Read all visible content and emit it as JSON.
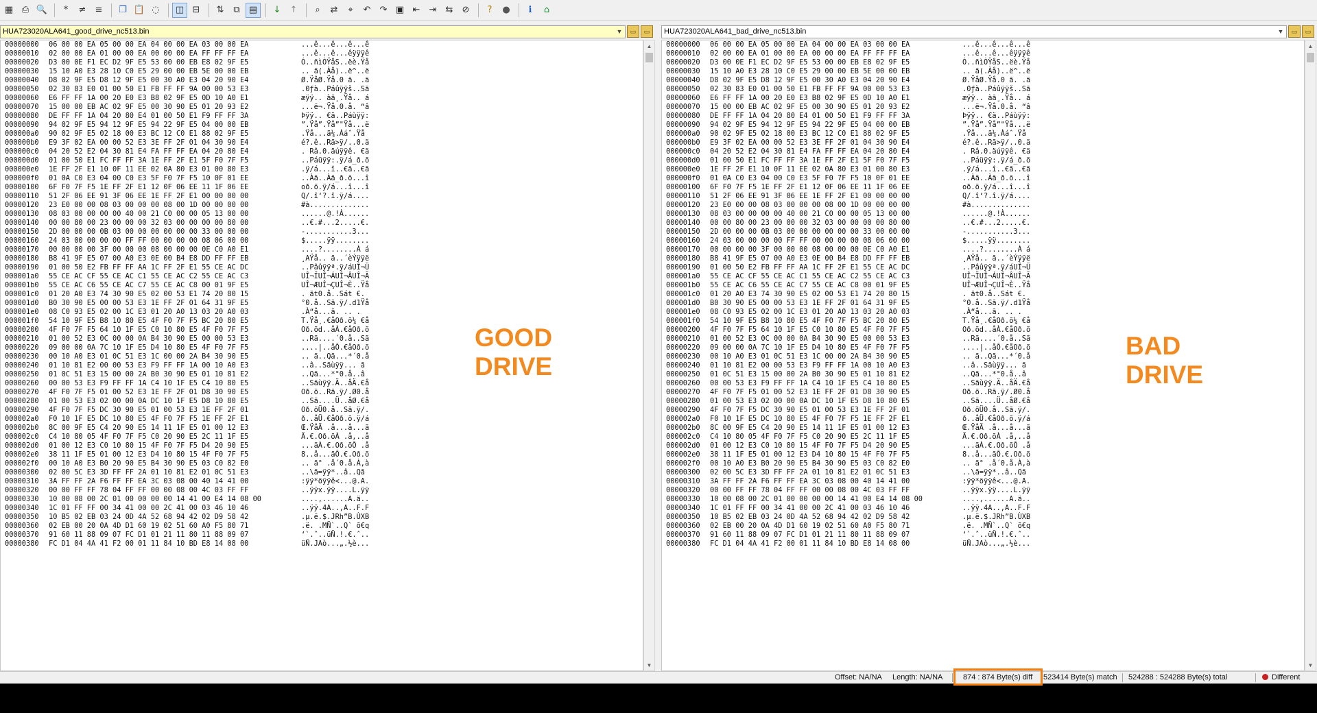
{
  "toolbar": {
    "icons": [
      "table-icon",
      "print-icon",
      "print-preview-icon",
      "asterisk-icon",
      "not-equal-icon",
      "equal-icon",
      "copy-icon",
      "paste-icon",
      "eraser-icon",
      "side-by-side-icon",
      "over-under-icon",
      "sync-icon",
      "compare-icon",
      "refresh-icon",
      "next-diff-icon",
      "prev-diff-icon",
      "find-icon",
      "replace-icon",
      "bookmark-icon",
      "undo-icon",
      "redo-icon",
      "save-icon",
      "copy-left-icon",
      "copy-right-icon",
      "copy-all-icon",
      "ignore-icon",
      "help-icon",
      "stop-icon",
      "info-icon",
      "home-icon"
    ]
  },
  "left": {
    "path": "HUA723020ALA641_good_drive_nc513.bin",
    "label_line1": "GOOD",
    "label_line2": "DRIVE",
    "accent": "#ffffc4"
  },
  "right": {
    "path": "HUA723020ALA641_bad_drive_nc513.bin",
    "label_line1": "BAD",
    "label_line2": "DRIVE"
  },
  "label_color": "#f28a20",
  "rows": [
    {
      "offset": "00000000",
      "hex": "06 00 00 EA 05 00 00 EA 04 00 00 EA 03 00 00 EA",
      "ascii": "...ê...ê...ê...ê"
    },
    {
      "offset": "00000010",
      "hex": "02 00 00 EA 01 00 00 EA 00 00 00 EA FF FF FF EA",
      "ascii": "...ê...ê...êÿÿÿê"
    },
    {
      "offset": "00000020",
      "hex": "D3 00 0E F1 EC D2 9F E5 53 00 00 EB E8 02 9F E5",
      "ascii": "Ó..ñìÒŸåS..ëè.Ÿå"
    },
    {
      "offset": "00000030",
      "hex": "15 10 A0 E3 28 10 C0 E5 29 00 00 EB 5E 00 00 EB",
      "ascii": ".. ã(.Àå)..ë^..ë"
    },
    {
      "offset": "00000040",
      "hex": "D8 02 9F E5 D8 12 9F E5 00 30 A0 E3 04 20 90 E4",
      "ascii": "Ø.ŸåØ.Ÿå.0 ã. .ä"
    },
    {
      "offset": "00000050",
      "hex": "02 30 83 E0 01 00 50 E1 FB FF FF 9A 00 00 53 E3",
      "ascii": ".0ƒà..Páûÿÿš..Sã"
    },
    {
      "offset": "00000060",
      "hex": "E6 FF FF 1A 00 20 E0 E3 B8 02 9F E5 0D 10 A0 E1",
      "ascii": "æÿÿ.. àã¸.Ÿå.. á"
    },
    {
      "offset": "00000070",
      "hex": "15 00 00 EB AC 02 9F E5 00 30 90 E5 01 20 93 E2",
      "ascii": "...ë¬.Ÿå.0.å. “â"
    },
    {
      "offset": "00000080",
      "hex": "DE FF FF 1A 04 20 80 E4 01 00 50 E1 F9 FF FF 3A",
      "ascii": "Þÿÿ.. €ä..Páùÿÿ:"
    },
    {
      "offset": "00000090",
      "hex": "94 02 9F E5 94 12 9F E5 94 22 9F E5 04 00 00 EB",
      "ascii": "”.Ÿå”.Ÿå”\"Ÿå...ë"
    },
    {
      "offset": "000000a0",
      "hex": "90 02 9F E5 02 18 00 E3 BC 12 C0 E1 88 02 9F E5",
      "ascii": ".Ÿå...ã¼.Àáˆ.Ÿå"
    },
    {
      "offset": "000000b0",
      "hex": "E9 3F 02 EA 00 00 52 E3 3E FF 2F 01 04 30 90 E4",
      "ascii": "é?.ê..Rã>ÿ/..0.ä"
    },
    {
      "offset": "000000c0",
      "hex": "04 20 52 E2 04 30 81 E4 FA FF FF EA 04 20 80 E4",
      "ascii": ". Râ.0.äúÿÿê. €ä"
    },
    {
      "offset": "000000d0",
      "hex": "01 00 50 E1 FC FF FF 3A 1E FF 2F E1 5F F0 7F F5",
      "ascii": "..Páüÿÿ:.ÿ/á_ð.õ"
    },
    {
      "offset": "000000e0",
      "hex": "1E FF 2F E1 10 0F 11 EE 02 0A 80 E3 01 00 80 E3",
      "ascii": ".ÿ/á...î..€ã..€ã"
    },
    {
      "offset": "000000f0",
      "hex": "01 0A C0 E3 04 00 C0 E3 5F F0 7F F5 10 0F 01 EE",
      "ascii": "..Àã..Àã_ð.õ...î"
    },
    {
      "offset": "00000100",
      "hex": "6F F0 7F F5 1E FF 2F E1 12 0F 06 EE 11 1F 06 EE",
      "ascii": "oð.õ.ÿ/á...î...î"
    },
    {
      "offset": "00000110",
      "hex": "51 2F 06 EE 91 3F 06 EE 1E FF 2F E1 00 00 00 00",
      "ascii": "Q/.î‘?.î.ÿ/á...."
    },
    {
      "offset": "00000120",
      "hex": "23 E0 00 00 08 03 00 00 00 08 00 1D 00 00 00 00",
      "ascii": "#à.............."
    },
    {
      "offset": "00000130",
      "hex": "08 03 00 00 00 00 40 00 21 C0 00 00 05 13 00 00",
      "ascii": "......@.!À......"
    },
    {
      "offset": "00000140",
      "hex": "00 00 80 00 23 00 00 00 32 03 00 00 00 00 80 00",
      "ascii": "..€.#...2.....€."
    },
    {
      "offset": "00000150",
      "hex": "2D 00 00 00 0B 03 00 00 00 00 00 00 33 00 00 00",
      "ascii": "-...........3..."
    },
    {
      "offset": "00000160",
      "hex": "24 03 00 00 00 00 FF FF 00 00 00 00 08 06 00 00",
      "ascii": "$.....ÿÿ........"
    },
    {
      "offset": "00000170",
      "hex": "00 00 00 00 3F 00 00 00 08 00 00 00 0E C0 A0 E1",
      "ascii": "....?........À á"
    },
    {
      "offset": "00000180",
      "hex": "B8 41 9F E5 07 00 A0 E3 0E 00 B4 E8 DD FF FF EB",
      "ascii": "¸AŸå.. ã..´èÝÿÿë"
    },
    {
      "offset": "00000190",
      "hex": "01 00 50 E2 FB FF FF AA 1C FF 2F E1 55 CE AC DC",
      "ascii": "..Pâûÿÿª.ÿ/áUÎ¬Ü"
    },
    {
      "offset": "000001a0",
      "hex": "55 CE AC CF 55 CE AC C1 55 CE AC C2 55 CE AC C3",
      "ascii": "UÎ¬ÏUÎ¬ÁUÎ¬ÂUÎ¬Ã"
    },
    {
      "offset": "000001b0",
      "hex": "55 CE AC C6 55 CE AC C7 55 CE AC C8 00 01 9F E5",
      "ascii": "UÎ¬ÆUÎ¬ÇUÎ¬È..Ÿå"
    },
    {
      "offset": "000001c0",
      "hex": "01 20 A0 E3 74 30 90 E5 02 00 53 E1 74 20 80 15",
      "ascii": ". ãt0.å..Sát €."
    },
    {
      "offset": "000001d0",
      "hex": "B0 30 90 E5 00 00 53 E3 1E FF 2F 01 64 31 9F E5",
      "ascii": "°0.å..Sã.ÿ/.d1Ÿå"
    },
    {
      "offset": "000001e0",
      "hex": "08 C0 93 E5 02 00 1C E3 01 20 A0 13 03 20 A0 03",
      "ascii": ".À“å...ã. .. ."
    },
    {
      "offset": "000001f0",
      "hex": "54 10 9F E5 B8 10 80 E5 4F F0 7F F5 BC 20 80 E5",
      "ascii": "T.Ÿå¸.€åOð.õ¼ €å"
    },
    {
      "offset": "00000200",
      "hex": "4F F0 7F F5 64 10 1F E5 C0 10 80 E5 4F F0 7F F5",
      "ascii": "Oð.õd..åÀ.€åOð.õ"
    },
    {
      "offset": "00000210",
      "hex": "01 00 52 E3 0C 00 00 0A B4 30 90 E5 00 00 53 E3",
      "ascii": "..Rã....´0.å..Sã"
    },
    {
      "offset": "00000220",
      "hex": "09 00 00 0A 7C 10 1F E5 D4 10 80 E5 4F F0 7F F5",
      "ascii": "....|..åÔ.€åOð.õ"
    },
    {
      "offset": "00000230",
      "hex": "00 10 A0 E3 01 0C 51 E3 1C 00 00 2A B4 30 90 E5",
      "ascii": ".. ã..Qã...*´0.å"
    },
    {
      "offset": "00000240",
      "hex": "01 10 81 E2 00 00 53 E3 F9 FF FF 1A 00 10 A0 E3",
      "ascii": "..â..Sãùÿÿ... ã"
    },
    {
      "offset": "00000250",
      "hex": "01 0C 51 E3 15 00 00 2A B0 30 90 E5 01 10 81 E2",
      "ascii": "..Qã...*°0.å..â"
    },
    {
      "offset": "00000260",
      "hex": "00 00 53 E3 F9 FF FF 1A C4 10 1F E5 C4 10 80 E5",
      "ascii": "..Sãùÿÿ.Ä..åÄ.€å"
    },
    {
      "offset": "00000270",
      "hex": "4F F0 7F F5 01 00 52 E3 1E FF 2F 01 D8 30 90 E5",
      "ascii": "Oð.õ..Rã.ÿ/.Ø0.å"
    },
    {
      "offset": "00000280",
      "hex": "01 00 53 E3 02 00 00 0A DC 10 1F E5 D8 10 80 E5",
      "ascii": "..Sã....Ü..åØ.€å"
    },
    {
      "offset": "00000290",
      "hex": "4F F0 7F F5 DC 30 90 E5 01 00 53 E3 1E FF 2F 01",
      "ascii": "Oð.õÜ0.å..Sã.ÿ/."
    },
    {
      "offset": "000002a0",
      "hex": "F0 10 1F E5 DC 10 80 E5 4F F0 7F F5 1E FF 2F E1",
      "ascii": "ð..åÜ.€åOð.õ.ÿ/á"
    },
    {
      "offset": "000002b0",
      "hex": "8C 00 9F E5 C4 20 90 E5 14 11 1F E5 01 00 12 E3",
      "ascii": "Œ.ŸåÄ .å...å...ã"
    },
    {
      "offset": "000002c0",
      "hex": "C4 10 80 05 4F F0 7F F5 C0 20 90 E5 2C 11 1F E5",
      "ascii": "Ä.€.Oð.õÀ .å,..å"
    },
    {
      "offset": "000002d0",
      "hex": "01 00 12 E3 C0 10 80 15 4F F0 7F F5 D4 20 90 E5",
      "ascii": "...ãÀ.€.Oð.õÔ .å"
    },
    {
      "offset": "000002e0",
      "hex": "38 11 1F E5 01 00 12 E3 D4 10 80 15 4F F0 7F F5",
      "ascii": "8..å...ãÔ.€.Oð.õ"
    },
    {
      "offset": "000002f0",
      "hex": "00 10 A0 E3 B0 20 90 E5 B4 30 90 E5 03 C0 82 E0",
      "ascii": ".. ã° .å´0.å.À‚à"
    },
    {
      "offset": "00000300",
      "hex": "02 00 5C E3 3D FF FF 2A 01 10 81 E2 01 0C 51 E3",
      "ascii": "..\\ã=ÿÿ*..â..Qã"
    },
    {
      "offset": "00000310",
      "hex": "3A FF FF 2A F6 FF FF EA 3C 03 08 00 40 14 41 00",
      "ascii": ":ÿÿ*öÿÿê<...@.A."
    },
    {
      "offset": "00000320",
      "hex": "00 00 FF FF 78 04 FF FF 00 00 08 00 4C 03 FF FF",
      "ascii": "..ÿÿx.ÿÿ....L.ÿÿ"
    },
    {
      "offset": "00000330",
      "hex": "10 00 08 00 2C 01 00 00 00 00 14 41 00 E4 14 08 00",
      "ascii": "....,......A.ä.."
    },
    {
      "offset": "00000340",
      "hex": "1C 01 FF FF 00 34 41 00 00 2C 41 00 03 46 10 46",
      "ascii": "..ÿÿ.4A..,A..F.F"
    },
    {
      "offset": "00000350",
      "hex": "10 B5 02 EB 03 24 0D 4A 52 68 94 42 02 D9 58 42",
      "ascii": ".µ.ë.$.JRh”B.ÙXB"
    },
    {
      "offset": "00000360",
      "hex": "02 EB 00 20 0A 4D D1 60 19 02 51 60 A0 F5 80 71",
      "ascii": ".ë. .MÑ`..Q` õ€q"
    },
    {
      "offset": "00000370",
      "hex": "91 60 11 88 09 07 FC D1 01 21 11 80 11 88 09 07",
      "ascii": "‘`.ˆ..üÑ.!.€.ˆ.."
    },
    {
      "offset": "00000380",
      "hex": "FC D1 04 4A 41 F2 00 01 11 84 10 BD E8 14 08 00",
      "ascii": "üÑ.JAò...„.½è..."
    }
  ],
  "status": {
    "offset": "Offset: NA/NA",
    "length": "Length: NA/NA",
    "diff": "874 : 874 Byte(s) diff",
    "match": "523414 Byte(s) match",
    "total": "524288 : 524288 Byte(s) total",
    "result": "Different",
    "highlight_color": "#f47d10",
    "result_color": "#c62020"
  }
}
